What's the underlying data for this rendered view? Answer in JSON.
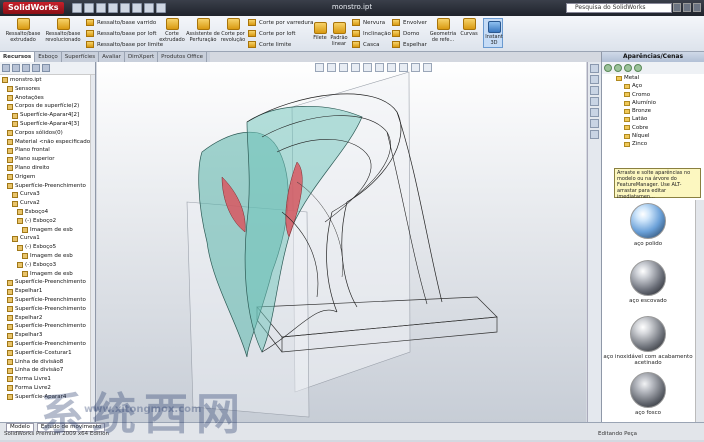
{
  "app": {
    "logo": "SolidWorks",
    "document_title": "monstro.ipt",
    "search_placeholder": "Pesquisa do SolidWorks"
  },
  "ribbon": {
    "large_buttons": [
      {
        "label": "Ressalto/base extrudado"
      },
      {
        "label": "Ressalto/base revolucionado"
      },
      {
        "label": "Corte extrudado"
      },
      {
        "label": "Assistente de Perfuração"
      },
      {
        "label": "Corte por revolução"
      },
      {
        "label": "Filete"
      },
      {
        "label": "Padrão linear"
      },
      {
        "label": "Geometria de refe..."
      },
      {
        "label": "Curvas"
      },
      {
        "label": "Instant 3D"
      }
    ],
    "small_buttons": [
      {
        "label": "Ressalto/base varrido"
      },
      {
        "label": "Ressalto/base por loft"
      },
      {
        "label": "Ressalto/base por limite"
      },
      {
        "label": "Corte por varredura"
      },
      {
        "label": "Corte por loft"
      },
      {
        "label": "Corte limite"
      },
      {
        "label": "Nervura"
      },
      {
        "label": "Inclinação"
      },
      {
        "label": "Casca"
      },
      {
        "label": "Envolver"
      },
      {
        "label": "Domo"
      },
      {
        "label": "Espelhar"
      }
    ]
  },
  "tabs": [
    "Recursos",
    "Esboço",
    "Superfícies",
    "Avaliar",
    "DimXpert",
    "Produtos Office"
  ],
  "feature_tree": [
    "monstro.ipt",
    "Sensores",
    "Anotações",
    "Corpos de superfície(2)",
    "Superfície-Aparar4[2]",
    "Superfície-Aparar4[3]",
    "Corpos sólidos(0)",
    "Material <não especificado>",
    "Plano frontal",
    "Plano superior",
    "Plano direito",
    "Origem",
    "Superfície-Preenchimento",
    "Curva3",
    "Curva2",
    "Esboço4",
    "(-) Esboço2",
    "Imagem de esb",
    "Curva1",
    "(-) Esboço5",
    "Imagem de esb",
    "(-) Esboço3",
    "Imagem de esb",
    "Superfície-Preenchimento",
    "Espelhar1",
    "Superfície-Preenchimento",
    "Superfície-Preenchimento",
    "Espelhar2",
    "Superfície-Preenchimento",
    "Espelhar3",
    "Superfície-Preenchimento",
    "Superfície-Costurar1",
    "Linha de divisão8",
    "Linha de divisão7",
    "Forma Livre1",
    "Forma Livre2",
    "Superfície-Aparar4"
  ],
  "task_pane": {
    "title": "Aparências/Cenas",
    "tree": [
      "Metal",
      "Aço",
      "Cromo",
      "Alumínio",
      "Bronze",
      "Latão",
      "Cobre",
      "Níquel",
      "Zinco"
    ],
    "tooltip": "Arraste e solte aparências no modelo ou na árvore do FeatureManager. Use ALT-arrastar para editar imediatamen...",
    "swatches": [
      {
        "label": "aço polido"
      },
      {
        "label": "aço escovado"
      },
      {
        "label": "aço inoxidável com acabamento acetinado"
      },
      {
        "label": "aço fosco"
      }
    ]
  },
  "status": {
    "left": "SolidWorks Premium 2009 x64 Edition",
    "right": "Editando Peça",
    "bottom_tabs": [
      "Modelo",
      "Estudo de movimento"
    ]
  },
  "watermark": {
    "chars": "系统西网",
    "url": "www.xitongmox.com"
  }
}
